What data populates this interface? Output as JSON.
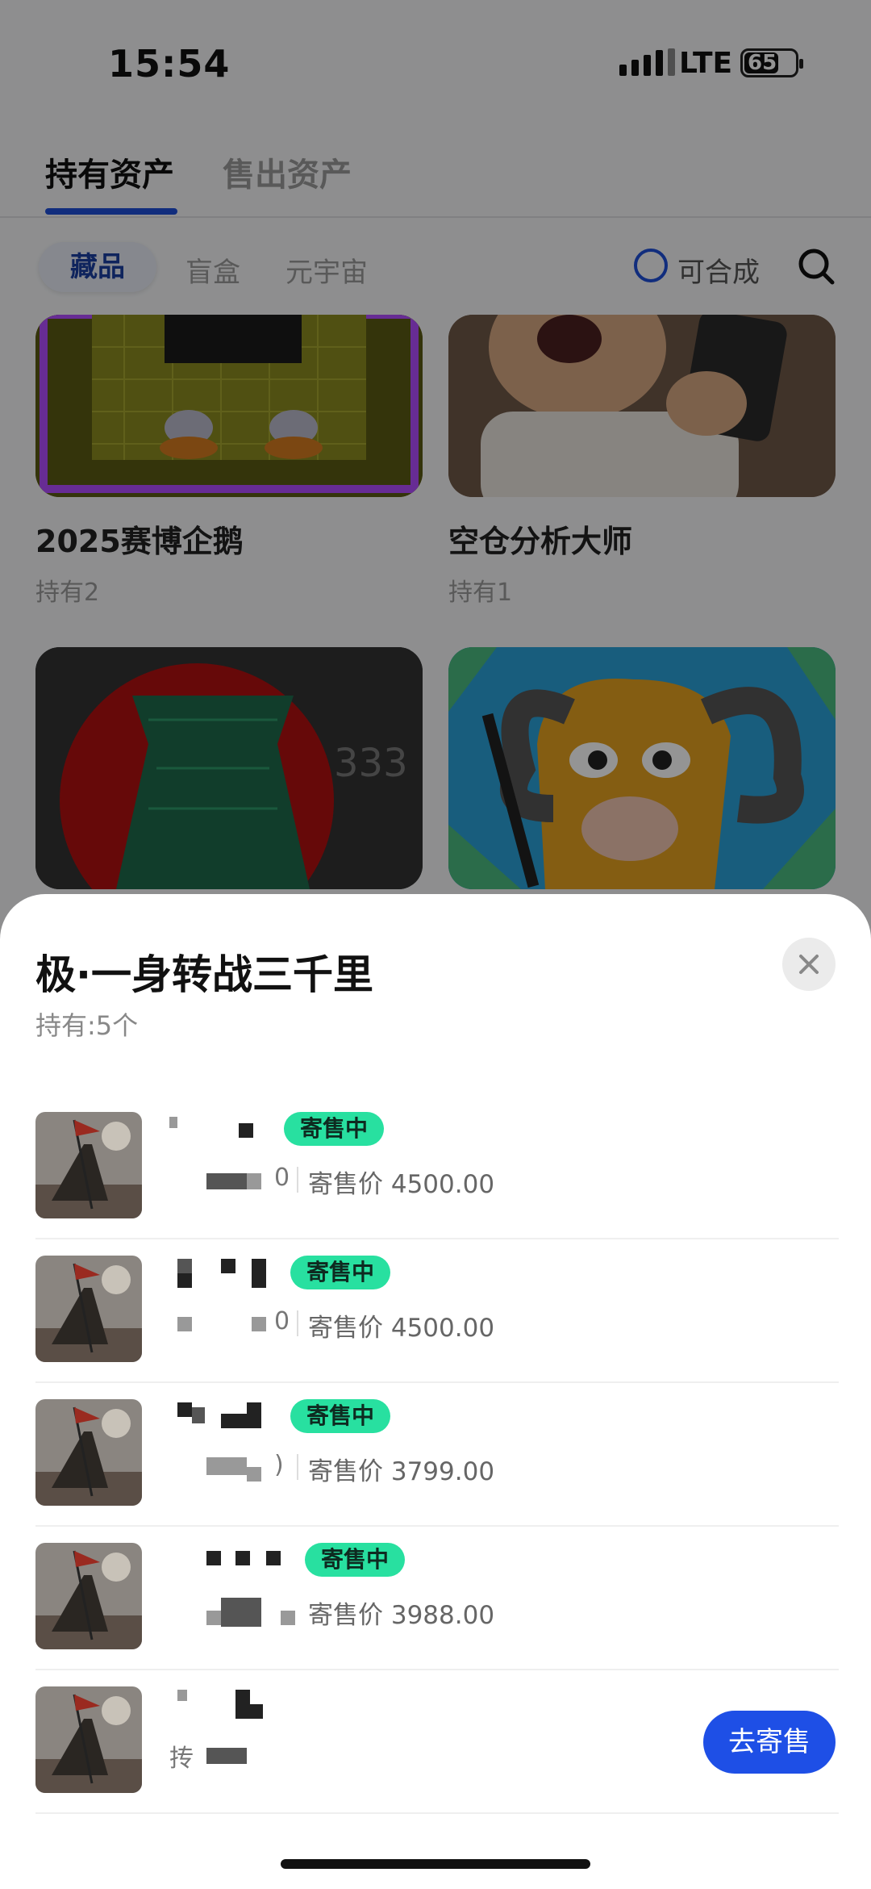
{
  "status_bar": {
    "time": "15:54",
    "network": "LTE",
    "battery": "65"
  },
  "tabs": [
    {
      "label": "持有资产",
      "active": true
    },
    {
      "label": "售出资产",
      "active": false
    }
  ],
  "filters": {
    "chips": [
      "藏品",
      "盲盒",
      "元宇宙"
    ],
    "active_chip": "藏品",
    "radio_label": "可合成"
  },
  "grid": [
    {
      "name": "2025赛博企鹅",
      "held": "持有2"
    },
    {
      "name": "空仓分析大师",
      "held": "持有1"
    },
    {
      "name": "",
      "held": ""
    },
    {
      "name": "",
      "held": ""
    }
  ],
  "sheet": {
    "title": "极·一身转战三千里",
    "subtitle": "持有:5个",
    "rows": [
      {
        "badge": "寄售中",
        "trail": "0",
        "price": "寄售价 4500.00"
      },
      {
        "badge": "寄售中",
        "trail": "0",
        "price": "寄售价 4500.00"
      },
      {
        "badge": "寄售中",
        "trail": ")",
        "price": "寄售价 3799.00"
      },
      {
        "badge": "寄售中",
        "trail": "",
        "price": "寄售价 3988.00"
      },
      {
        "badge": "",
        "trail": "抟",
        "price": ""
      }
    ],
    "action_button": "去寄售"
  },
  "colors": {
    "accent": "#1e4fd8",
    "badge": "#28e0a0"
  }
}
